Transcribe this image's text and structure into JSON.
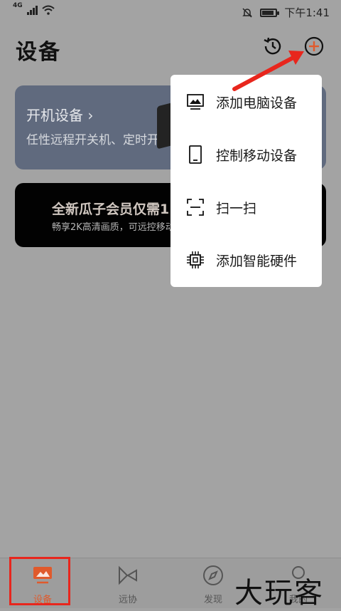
{
  "status_bar": {
    "network": "4G",
    "time": "下午1:41"
  },
  "header": {
    "title": "设备",
    "history_icon": "history-clock-icon",
    "add_icon": "plus-circle-icon"
  },
  "cards": {
    "power": {
      "title": "开机设备 ›",
      "subtitle": "任性远程开关机、定时开"
    },
    "vip": {
      "title": "全新瓜子会员仅需1",
      "subtitle": "畅享2K高清画质，可远控移动"
    }
  },
  "menu": {
    "items": [
      {
        "label": "添加电脑设备",
        "icon": "computer-icon"
      },
      {
        "label": "控制移动设备",
        "icon": "tablet-icon"
      },
      {
        "label": "扫一扫",
        "icon": "scan-icon"
      },
      {
        "label": "添加智能硬件",
        "icon": "chip-icon"
      }
    ]
  },
  "tabbar": {
    "tabs": [
      {
        "label": "设备",
        "icon": "device-icon",
        "active": true
      },
      {
        "label": "远协",
        "icon": "remote-assist-icon",
        "active": false
      },
      {
        "label": "发现",
        "icon": "compass-icon",
        "active": false
      },
      {
        "label": "我的",
        "icon": "profile-icon",
        "active": false
      }
    ]
  },
  "watermark": "大玩客",
  "colors": {
    "accent": "#e05a2c",
    "annotation_red": "#e8261d",
    "overlay_bg": "#a3a3a3",
    "menu_bg": "#ffffff"
  }
}
